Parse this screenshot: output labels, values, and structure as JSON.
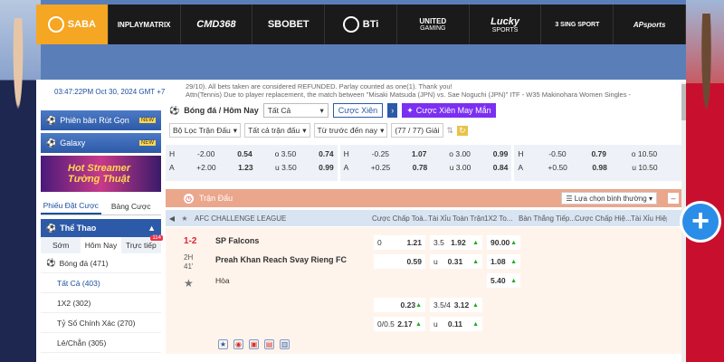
{
  "brands": [
    {
      "name": "SABA",
      "sub": ""
    },
    {
      "name": "INPLAYMATRIX",
      "sub": ""
    },
    {
      "name": "CMD368",
      "sub": ""
    },
    {
      "name": "SBOBET",
      "sub": ""
    },
    {
      "name": "BTi",
      "sub": ""
    },
    {
      "name": "UNITED",
      "sub": "GAMING"
    },
    {
      "name": "Lucky",
      "sub": "SPORTS"
    },
    {
      "name": "3 SING SPORT",
      "sub": ""
    },
    {
      "name": "APsports",
      "sub": ""
    }
  ],
  "datetime": "03:47:22PM Oct 30, 2024 GMT +7",
  "marquee": {
    "line1": "29/10). All bets taken are considered REFUNDED. Parlay counted as one(1). Thank you!",
    "line2": "Attn(Tennis) Due to player replacement, the match between \"Misaki Matsuda (JPN) vs. Sae Noguchi (JPN)\" ITF - W35 Makinohara Women Singles -"
  },
  "sidebar": {
    "btn1": "Phiên bản Rút Gọn",
    "btn2": "Galaxy",
    "new": "NEW",
    "streamer1": "Hot Streamer",
    "streamer2": "Tường Thuật",
    "tab_slip": "Phiếu Đặt Cược",
    "tab_table": "Bảng Cược",
    "sport_head": "Thể Thao",
    "sport_tabs": [
      "Sớm",
      "Hôm Nay",
      "Trực tiếp"
    ],
    "live_count": "114",
    "football": "Bóng đá",
    "football_count": "(471)",
    "items": [
      "Tất Cả (403)",
      "1X2 (302)",
      "Tỷ Số Chính Xác (270)",
      "Lẻ/Chẵn (305)"
    ]
  },
  "toolbar": {
    "title": "Bóng đá / Hôm Nay",
    "select": "Tất Cả",
    "parlay": "Cược Xiên",
    "lucky_parlay": "Cược Xiên May Mắn"
  },
  "filters": {
    "league": "Bộ Lọc Trận Đấu",
    "matches": "Tất cả trận đấu",
    "time": "Từ trước đến nay",
    "count": "(77 / 77) Giải"
  },
  "odds_strip": [
    [
      [
        "H",
        "-2.00",
        "0.54",
        "o 3.50",
        "0.74"
      ],
      [
        "A",
        "+2.00",
        "1.23",
        "u 3.50",
        "0.99"
      ]
    ],
    [
      [
        "H",
        "-0.25",
        "1.07",
        "o 3.00",
        "0.99"
      ],
      [
        "A",
        "+0.25",
        "0.78",
        "u 3.00",
        "0.84"
      ]
    ],
    [
      [
        "H",
        "-0.50",
        "0.79",
        "o 10.50",
        ""
      ],
      [
        "A",
        "+0.50",
        "0.98",
        "u 10.50",
        ""
      ]
    ]
  ],
  "section": {
    "title": "Trận Đấu",
    "sort": "Lựa chọn bình thường"
  },
  "thead": {
    "league": "AFC CHALLENGE LEAGUE",
    "cols": [
      "Cược Chấp Toà...",
      "Tài Xỉu Toàn Trận",
      "1X2 To...",
      "Bàn Thắng Tiếp...",
      "Cược Chấp Hiệ...",
      "Tài Xỉu Hiệp"
    ]
  },
  "match": {
    "score": "1-2",
    "half": "2H",
    "minute": "41'",
    "home": "SP Falcons",
    "away": "Preah Khan Reach Svay Rieng FC",
    "draw": "Hòa",
    "r1": {
      "hdp": "0",
      "hdp_odds": "1.21",
      "ou": "3.5",
      "ou_odds": "1.92",
      "x12": "90.00"
    },
    "r2": {
      "hdp_odds": "0.59",
      "ou": "u",
      "ou_odds": "0.31",
      "x12": "1.08"
    },
    "r3": {
      "x12": "5.40"
    },
    "r4": {
      "hdp_odds": "0.23",
      "ou": "3.5/4",
      "ou_odds": "3.12"
    },
    "r5": {
      "hdp": "0/0.5",
      "hdp_odds": "2.17",
      "ou": "u",
      "ou_odds": "0.11"
    }
  }
}
